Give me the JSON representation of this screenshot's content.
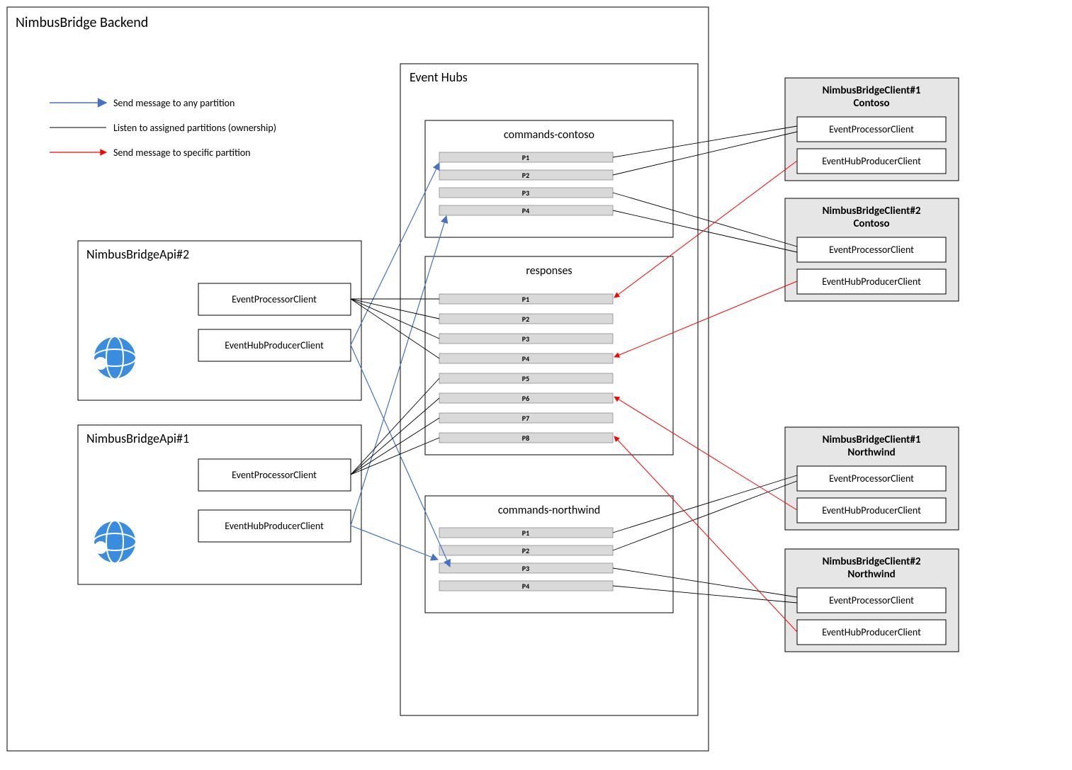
{
  "backend_title": "NimbusBridge Backend",
  "eventhubs_title": "Event Hubs",
  "legend": {
    "blue": "Send message to any partition",
    "black": "Listen to assigned partitions (ownership)",
    "red": "Send message to specific partition"
  },
  "apis": {
    "api2": {
      "title": "NimbusBridgeApi#2",
      "processor": "EventProcessorClient",
      "producer": "EventHubProducerClient"
    },
    "api1": {
      "title": "NimbusBridgeApi#1",
      "processor": "EventProcessorClient",
      "producer": "EventHubProducerClient"
    }
  },
  "hubs": {
    "commands_contoso": {
      "title": "commands-contoso",
      "partitions": [
        "P1",
        "P2",
        "P3",
        "P4"
      ]
    },
    "responses": {
      "title": "responses",
      "partitions": [
        "P1",
        "P2",
        "P3",
        "P4",
        "P5",
        "P6",
        "P7",
        "P8"
      ]
    },
    "commands_northwind": {
      "title": "commands-northwind",
      "partitions": [
        "P1",
        "P2",
        "P3",
        "P4"
      ]
    }
  },
  "clients": {
    "c1_contoso": {
      "title1": "NimbusBridgeClient#1",
      "title2": "Contoso",
      "processor": "EventProcessorClient",
      "producer": "EventHubProducerClient"
    },
    "c2_contoso": {
      "title1": "NimbusBridgeClient#2",
      "title2": "Contoso",
      "processor": "EventProcessorClient",
      "producer": "EventHubProducerClient"
    },
    "c1_northwind": {
      "title1": "NimbusBridgeClient#1",
      "title2": "Northwind",
      "processor": "EventProcessorClient",
      "producer": "EventHubProducerClient"
    },
    "c2_northwind": {
      "title1": "NimbusBridgeClient#2",
      "title2": "Northwind",
      "processor": "EventProcessorClient",
      "producer": "EventHubProducerClient"
    }
  },
  "colors": {
    "border": "#000000",
    "grey_fill": "#e6e6e6",
    "part_fill": "#d9d9d9",
    "blue": "#4472c4",
    "red": "#ff0000",
    "globe": "#3a8dde"
  }
}
